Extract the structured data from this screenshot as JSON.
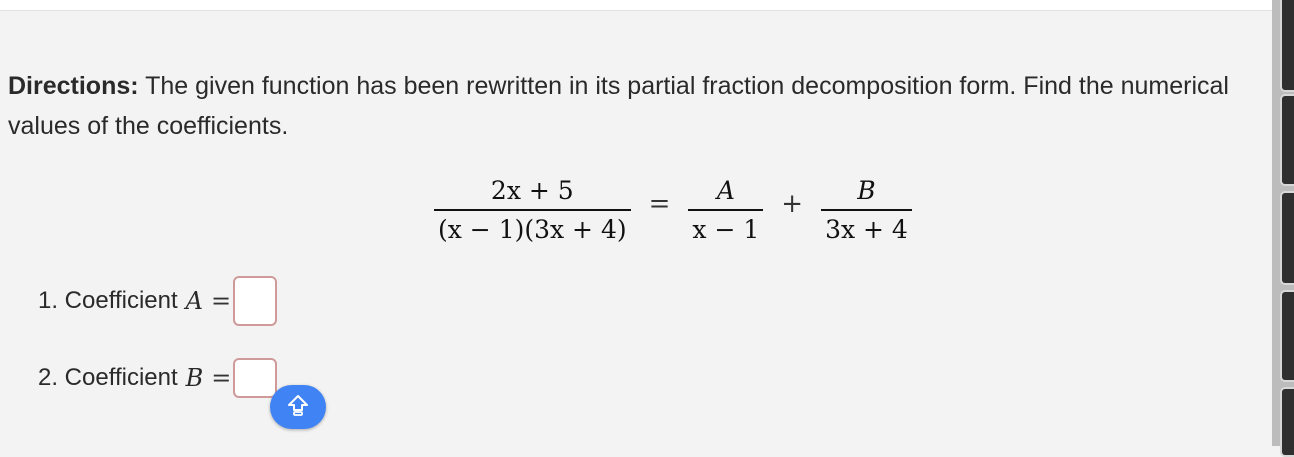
{
  "directions": {
    "label": "Directions:",
    "text": " The given function has been rewritten in its partial fraction decomposition form. Find the numerical values of the coefficients."
  },
  "equation": {
    "lhs_numerator": "2x + 5",
    "lhs_denominator": "(x − 1)(3x + 4)",
    "equals": "=",
    "term1_numerator": "A",
    "term1_denominator": "x − 1",
    "plus": "+",
    "term2_numerator": "B",
    "term2_denominator": "3x + 4"
  },
  "questions": [
    {
      "label": "1. Coefficient",
      "variable": "A",
      "equals": "=",
      "value": ""
    },
    {
      "label": "2. Coefficient",
      "variable": "B",
      "equals": "=",
      "value": ""
    }
  ],
  "floating_button": {
    "icon": "arrow-up-toggle-icon",
    "color": "#3f83f4"
  },
  "colors": {
    "background": "#f3f3f3",
    "input_border": "#cf9a9a",
    "rail": "#2f2f2f"
  }
}
